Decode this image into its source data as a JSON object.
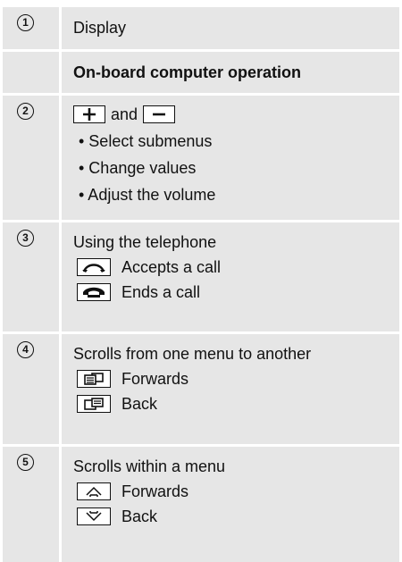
{
  "rows": [
    {
      "number": "1",
      "text": "Display"
    },
    {
      "heading": "On-board computer operation"
    },
    {
      "number": "2",
      "and_text": "and",
      "bullets": [
        "• Select submenus",
        "• Change values",
        "• Adjust the volume"
      ]
    },
    {
      "number": "3",
      "title": "Using the telephone",
      "items": [
        {
          "icon": "phone-accept-icon",
          "label": "Accepts a call"
        },
        {
          "icon": "phone-end-icon",
          "label": "Ends a call"
        }
      ]
    },
    {
      "number": "4",
      "title": "Scrolls from one menu to another",
      "items": [
        {
          "icon": "menu-forward-icon",
          "label": "Forwards"
        },
        {
          "icon": "menu-back-icon",
          "label": "Back"
        }
      ]
    },
    {
      "number": "5",
      "title": "Scrolls within a menu",
      "items": [
        {
          "icon": "arrow-up-icon",
          "label": "Forwards"
        },
        {
          "icon": "arrow-down-icon",
          "label": "Back"
        }
      ]
    }
  ]
}
